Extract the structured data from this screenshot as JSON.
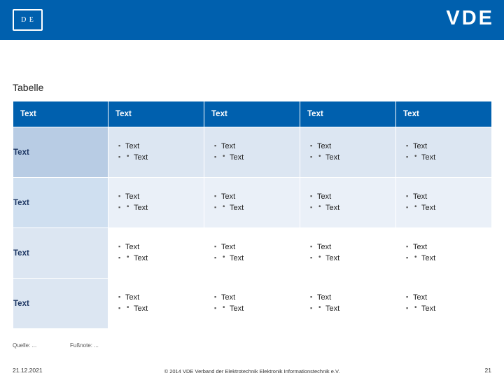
{
  "header": {
    "logo_text": "D E",
    "brand": "VDE",
    "brand_color": "#0060ae"
  },
  "slide": {
    "title": "Tabelle"
  },
  "table": {
    "headers": [
      "Text",
      "Text",
      "Text",
      "Text",
      "Text"
    ],
    "rows": [
      {
        "label": "Text",
        "cells": [
          {
            "level1": "Text",
            "level2": "Text"
          },
          {
            "level1": "Text",
            "level2": "Text"
          },
          {
            "level1": "Text",
            "level2": "Text"
          },
          {
            "level1": "Text",
            "level2": "Text"
          }
        ]
      },
      {
        "label": "Text",
        "cells": [
          {
            "level1": "Text",
            "level2": "Text"
          },
          {
            "level1": "Text",
            "level2": "Text"
          },
          {
            "level1": "Text",
            "level2": "Text"
          },
          {
            "level1": "Text",
            "level2": "Text"
          }
        ]
      },
      {
        "label": "Text",
        "cells": [
          {
            "level1": "Text",
            "level2": "Text"
          },
          {
            "level1": "Text",
            "level2": "Text"
          },
          {
            "level1": "Text",
            "level2": "Text"
          },
          {
            "level1": "Text",
            "level2": "Text"
          }
        ]
      },
      {
        "label": "Text",
        "cells": [
          {
            "level1": "Text",
            "level2": "Text"
          },
          {
            "level1": "Text",
            "level2": "Text"
          },
          {
            "level1": "Text",
            "level2": "Text"
          },
          {
            "level1": "Text",
            "level2": "Text"
          }
        ]
      }
    ]
  },
  "notes": {
    "source": "Quelle: ...",
    "footnote": "Fußnote: ..."
  },
  "footer": {
    "date": "21.12.2021",
    "copyright": "© 2014 VDE Verband der Elektrotechnik Elektronik Informationstechnik e.V.",
    "page": "21"
  }
}
